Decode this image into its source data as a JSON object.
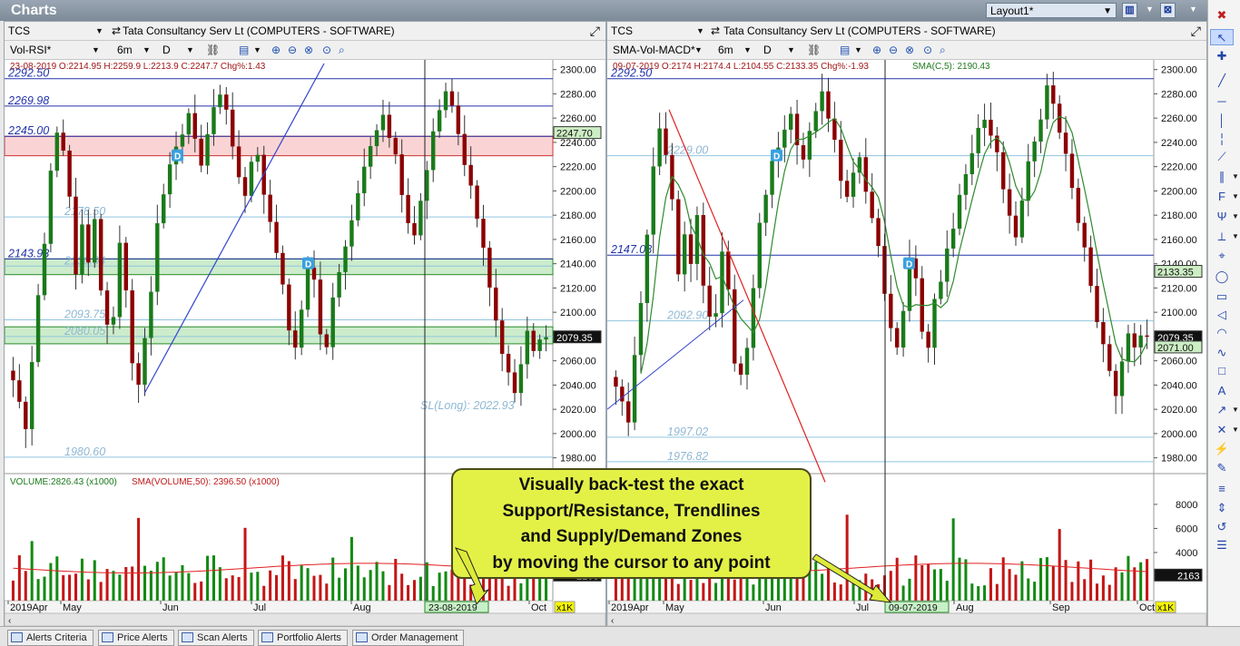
{
  "app": {
    "title": "Charts",
    "layout_label": "Layout1*"
  },
  "tabs": [
    "Alerts Criteria",
    "Price Alerts",
    "Scan Alerts",
    "Portfolio Alerts",
    "Order Management"
  ],
  "callout": {
    "lines": [
      "Visually back-test the exact",
      "Support/Resistance, Trendlines",
      "and Supply/Demand Zones",
      "by moving the cursor to any point"
    ]
  },
  "colors": {
    "up": "#1a7a1a",
    "down": "#8b0000",
    "volume_up": "#138a13",
    "volume_down": "#c41616",
    "callout": "#e3f147"
  },
  "panels": [
    {
      "symbol": "TCS",
      "name": "Tata Consultancy Serv Lt (COMPUTERS - SOFTWARE)",
      "template": "Vol-RSI*",
      "period": "6m",
      "interval": "D",
      "ohlc": "23-08-2019 O:2214.95 H:2259.9 L:2213.9 C:2247.7 Chg%:1.43",
      "sma_text": "",
      "volume_text": "VOLUME:2826.43 (x1000)",
      "volume_sma_text": "SMA(VOLUME,50): 2396.50 (x1000)",
      "cursor_date": "23-08-2019",
      "price_labels": [
        {
          "text": "2247.70",
          "value": 2247.7,
          "type": "green"
        },
        {
          "text": "2079.35",
          "value": 2079.35,
          "type": "black"
        }
      ],
      "volume_label": "2163",
      "multiplier": "x1K",
      "months": [
        "2019Apr",
        "May",
        "Jun",
        "Jul",
        "Aug",
        "Oct"
      ],
      "hlines": [
        {
          "text": "2292.50",
          "value": 2292.5,
          "style": "blue"
        },
        {
          "text": "2269.98",
          "value": 2269.98,
          "style": "blue"
        },
        {
          "text": "2245.00",
          "value": 2245.0,
          "style": "blue"
        },
        {
          "text": "2143.93",
          "value": 2143.93,
          "style": "blue"
        },
        {
          "text": "2178.50",
          "value": 2178.5,
          "style": "light"
        },
        {
          "text": "2138.04",
          "value": 2138.04,
          "style": "light"
        },
        {
          "text": "2093.75",
          "value": 2093.75,
          "style": "light"
        },
        {
          "text": "2080.05",
          "value": 2080.05,
          "style": "light"
        },
        {
          "text": "1980.60",
          "value": 1980.6,
          "style": "light"
        }
      ],
      "sl_text": "SL(Long): 2022.93",
      "sl_value": 2022.93,
      "zones": [
        {
          "from": 2229,
          "to": 2245,
          "type": "supply"
        },
        {
          "from": 2131,
          "to": 2144,
          "type": "demand"
        },
        {
          "from": 2074,
          "to": 2088,
          "type": "demand"
        }
      ]
    },
    {
      "symbol": "TCS",
      "name": "Tata Consultancy Serv Lt (COMPUTERS - SOFTWARE)",
      "template": "SMA-Vol-MACD*",
      "period": "6m",
      "interval": "D",
      "ohlc": "09-07-2019 O:2174 H:2174.4 L:2104.55 C:2133.35 Chg%:-1.93",
      "sma_text": "SMA(C,5): 2190.43",
      "volume_text": "",
      "volume_sma_text": "",
      "cursor_date": "09-07-2019",
      "price_labels": [
        {
          "text": "2133.35",
          "value": 2133.35,
          "type": "green"
        },
        {
          "text": "2079.35",
          "value": 2079.35,
          "type": "black"
        },
        {
          "text": "2071.00",
          "value": 2071.0,
          "type": "green"
        }
      ],
      "volume_label": "2163",
      "multiplier": "x1K",
      "months": [
        "2019Apr",
        "May",
        "Jun",
        "Jul",
        "Aug",
        "Sep",
        "Oct"
      ],
      "hlines": [
        {
          "text": "2292.50",
          "value": 2292.5,
          "style": "blue"
        },
        {
          "text": "2147.08",
          "value": 2147.08,
          "style": "blue"
        },
        {
          "text": "2229.00",
          "value": 2229.0,
          "style": "light"
        },
        {
          "text": "2092.90",
          "value": 2092.9,
          "style": "light"
        },
        {
          "text": "1997.02",
          "value": 1997.02,
          "style": "light"
        },
        {
          "text": "1976.82",
          "value": 1976.82,
          "style": "light"
        }
      ],
      "sl_text": "",
      "zones": []
    }
  ],
  "chart_data": {
    "type": "candlestick",
    "symbol": "TCS",
    "price_axis_ticks": [
      2300,
      2280,
      2260,
      2240,
      2220,
      2200,
      2180,
      2160,
      2140,
      2120,
      2100,
      2080,
      2060,
      2040,
      2020,
      2000,
      1980
    ],
    "volume_axis_ticks": [
      8000,
      6000,
      4000
    ],
    "ylim": [
      1970,
      2305
    ],
    "volume_ylim": [
      0,
      9500
    ],
    "close_path": [
      2040,
      2022,
      2008,
      2060,
      2110,
      2160,
      2218,
      2248,
      2232,
      2198,
      2135,
      2168,
      2142,
      2180,
      2118,
      2092,
      2100,
      2155,
      2120,
      2060,
      2045,
      2075,
      2120,
      2170,
      2198,
      2225,
      2236,
      2248,
      2262,
      2242,
      2225,
      2250,
      2270,
      2284,
      2262,
      2238,
      2210,
      2195,
      2220,
      2232,
      2198,
      2175,
      2150,
      2120,
      2086,
      2072,
      2105,
      2140,
      2125,
      2086,
      2074,
      2110,
      2130,
      2150,
      2172,
      2195,
      2218,
      2236,
      2250,
      2258,
      2246,
      2232,
      2200,
      2175,
      2162,
      2190,
      2220,
      2245,
      2262,
      2284,
      2270,
      2248,
      2226,
      2200,
      2178,
      2150,
      2120,
      2094,
      2070,
      2048,
      2030,
      2060,
      2080,
      2072,
      2076,
      2078
    ]
  }
}
